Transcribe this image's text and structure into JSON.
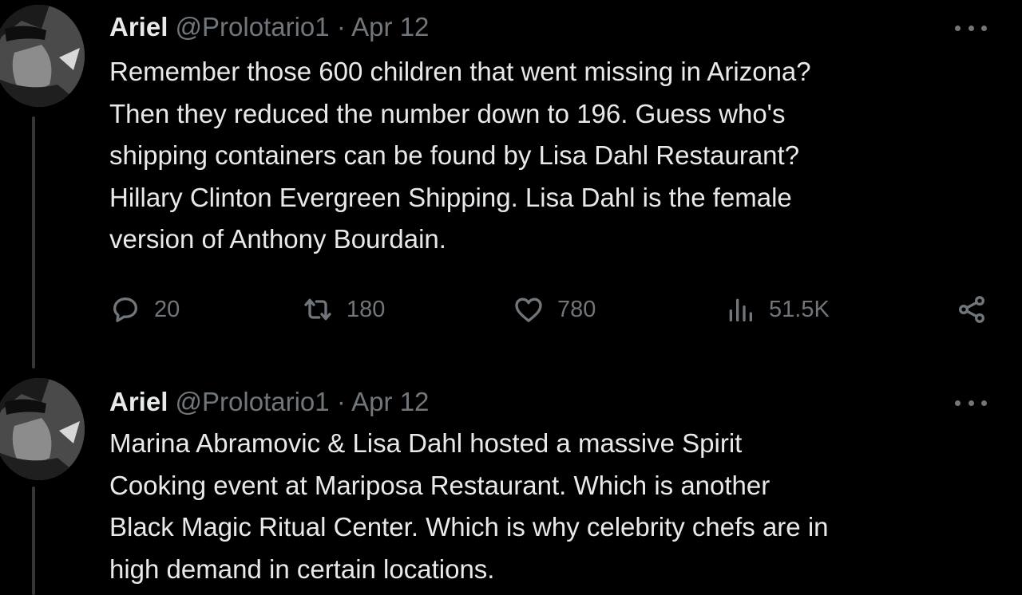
{
  "tweets": [
    {
      "author": {
        "name": "Ariel",
        "handle": "@Prolotario1",
        "separator": "·",
        "date": "Apr 12"
      },
      "lines": [
        "Remember those 600 children that went missing in Arizona?",
        "Then they reduced the number down to 196. Guess who's",
        "shipping containers can be found by Lisa Dahl Restaurant?",
        "Hillary Clinton Evergreen Shipping. Lisa Dahl is the female",
        "version of Anthony Bourdain."
      ],
      "stats": {
        "replies": "20",
        "retweets": "180",
        "likes": "780",
        "views": "51.5K"
      }
    },
    {
      "author": {
        "name": "Ariel",
        "handle": "@Prolotario1",
        "separator": "·",
        "date": "Apr 12"
      },
      "lines": [
        "Marina Abramovic & Lisa Dahl hosted a massive Spirit",
        "Cooking event at Mariposa Restaurant. Which is another",
        "Black Magic Ritual Center. Which is why celebrity chefs are in",
        "high demand in certain locations."
      ]
    }
  ],
  "icons": {
    "avatar": "avatar-image",
    "more": "more-options-icon",
    "reply": "reply-icon",
    "retweet": "retweet-icon",
    "like": "like-icon",
    "views": "views-icon",
    "share": "share-icon"
  },
  "colors": {
    "background": "#000000",
    "text": "#e7e9ea",
    "secondary": "#71767b",
    "thread_line": "#333639"
  }
}
